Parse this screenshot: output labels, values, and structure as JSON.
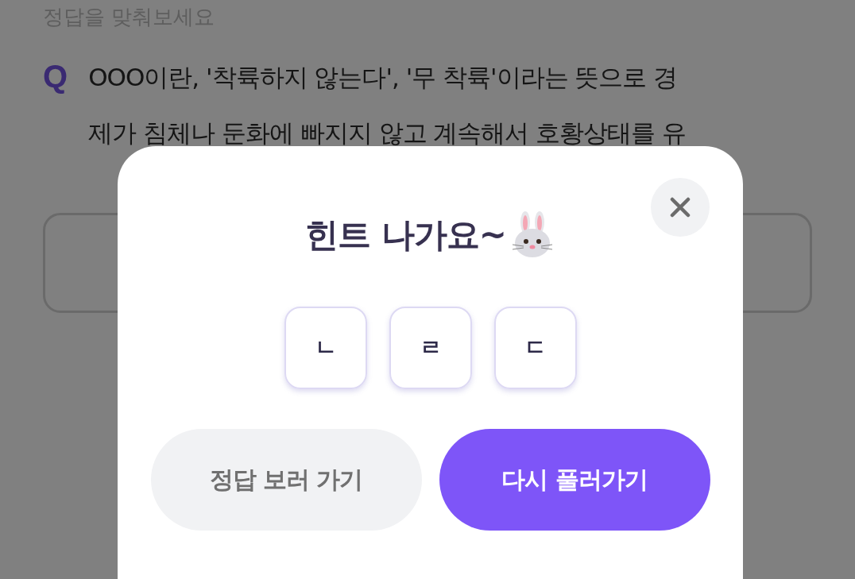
{
  "page": {
    "instruction": "정답을 맞춰보세요",
    "question_mark": "Q",
    "question_line": "OOO이란, '착륙하지 않는다', '무 착륙'이라는 뜻으로 경",
    "question_line_2": "제가 침체나 둔화에 빠지지 않고 계속해서 호황상태를 유"
  },
  "dialog": {
    "title": "힌트 나가요~",
    "hints": [
      "ㄴ",
      "ㄹ",
      "ㄷ"
    ],
    "buttons": [
      {
        "label": "정답 보러 가기",
        "kind": "secondary"
      },
      {
        "label": "다시 풀러가기",
        "kind": "primary"
      }
    ]
  }
}
